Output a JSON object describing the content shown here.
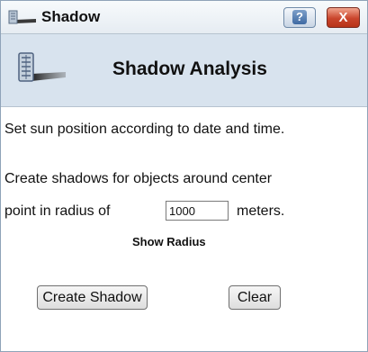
{
  "window": {
    "title": "Shadow",
    "help_label": "?",
    "close_label": "X"
  },
  "header": {
    "title": "Shadow Analysis"
  },
  "content": {
    "sun_text": "Set sun position according to date and time.",
    "shadow_text_line1": "Create shadows for objects around center",
    "shadow_text_line2": "point in radius of",
    "radius_value": "1000",
    "radius_unit": "meters.",
    "show_radius_label": "Show Radius"
  },
  "buttons": {
    "create_label": "Create Shadow",
    "clear_label": "Clear"
  },
  "icons": {
    "title_icon": "shadow-building-icon",
    "header_icon": "shadow-building-icon"
  }
}
